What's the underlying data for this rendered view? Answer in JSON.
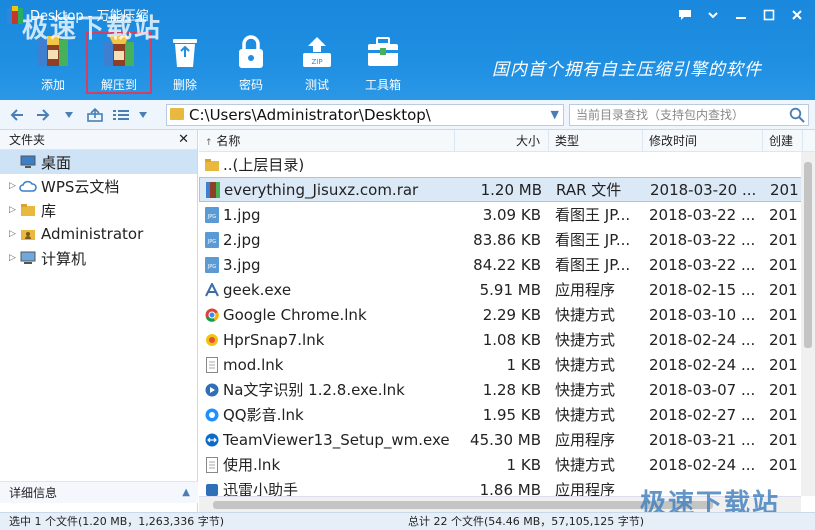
{
  "window": {
    "title": "Desktop - 万能压缩"
  },
  "window_controls": [
    "comment-icon",
    "dropdown-icon",
    "minimize-icon",
    "maximize-icon",
    "close-icon"
  ],
  "toolbar": {
    "buttons": [
      {
        "label": "添加",
        "icon": "add-archive-icon"
      },
      {
        "label": "解压到",
        "icon": "extract-icon",
        "selected": true
      },
      {
        "label": "删除",
        "icon": "recycle-bin-icon"
      },
      {
        "label": "密码",
        "icon": "lock-icon"
      },
      {
        "label": "测试",
        "icon": "test-zip-icon"
      },
      {
        "label": "工具箱",
        "icon": "toolbox-icon"
      }
    ],
    "slogan": "国内首个拥有自主压缩引擎的软件"
  },
  "watermark": {
    "text": "极速下载站"
  },
  "navbar": {
    "address": "C:\\Users\\Administrator\\Desktop\\",
    "search_placeholder": "当前目录查找（支持包内查找）"
  },
  "left_panel": {
    "header": "文件夹",
    "tree": [
      {
        "label": "桌面",
        "icon": "desktop-icon",
        "selected": true
      },
      {
        "label": "WPS云文档",
        "icon": "cloud-icon"
      },
      {
        "label": "库",
        "icon": "library-folder-icon"
      },
      {
        "label": "Administrator",
        "icon": "user-folder-icon"
      },
      {
        "label": "计算机",
        "icon": "computer-icon"
      }
    ],
    "footer": "详细信息"
  },
  "file_list": {
    "columns": {
      "name": "名称",
      "size": "大小",
      "type": "类型",
      "modified": "修改时间",
      "created": "创建"
    },
    "rows": [
      {
        "name": "..(上层目录)",
        "size": "",
        "type": "",
        "modified": "",
        "created": "",
        "icon": "folder-icon"
      },
      {
        "name": "everything_Jisuxz.com.rar",
        "size": "1.20 MB",
        "type": "RAR 文件",
        "modified": "2018-03-20 ...",
        "created": "201",
        "icon": "rar-icon",
        "selected": true
      },
      {
        "name": "1.jpg",
        "size": "3.09 KB",
        "type": "看图王 JP...",
        "modified": "2018-03-22 ...",
        "created": "201",
        "icon": "jpg-icon"
      },
      {
        "name": "2.jpg",
        "size": "83.86 KB",
        "type": "看图王 JP...",
        "modified": "2018-03-22 ...",
        "created": "201",
        "icon": "jpg-icon"
      },
      {
        "name": "3.jpg",
        "size": "84.22 KB",
        "type": "看图王 JP...",
        "modified": "2018-03-22 ...",
        "created": "201",
        "icon": "jpg-icon"
      },
      {
        "name": "geek.exe",
        "size": "5.91 MB",
        "type": "应用程序",
        "modified": "2018-02-15 ...",
        "created": "201",
        "icon": "geek-icon"
      },
      {
        "name": "Google Chrome.lnk",
        "size": "2.29 KB",
        "type": "快捷方式",
        "modified": "2018-03-10 ...",
        "created": "201",
        "icon": "chrome-icon"
      },
      {
        "name": "HprSnap7.lnk",
        "size": "1.08 KB",
        "type": "快捷方式",
        "modified": "2018-02-24 ...",
        "created": "201",
        "icon": "hypersnap-icon"
      },
      {
        "name": "mod.lnk",
        "size": "1 KB",
        "type": "快捷方式",
        "modified": "2018-02-24 ...",
        "created": "201",
        "icon": "document-icon"
      },
      {
        "name": "Na文字识别 1.2.8.exe.lnk",
        "size": "1.28 KB",
        "type": "快捷方式",
        "modified": "2018-03-07 ...",
        "created": "201",
        "icon": "play-icon"
      },
      {
        "name": "QQ影音.lnk",
        "size": "1.95 KB",
        "type": "快捷方式",
        "modified": "2018-02-27 ...",
        "created": "201",
        "icon": "qq-player-icon"
      },
      {
        "name": "TeamViewer13_Setup_wm.exe",
        "size": "45.30 MB",
        "type": "应用程序",
        "modified": "2018-03-21 ...",
        "created": "201",
        "icon": "teamviewer-icon"
      },
      {
        "name": "使用.lnk",
        "size": "1 KB",
        "type": "快捷方式",
        "modified": "2018-02-24 ...",
        "created": "201",
        "icon": "document-icon"
      },
      {
        "name": "迅雷小助手",
        "size": "1.86 MB",
        "type": "应用程序",
        "modified": "",
        "created": "",
        "icon": "app-icon"
      }
    ]
  },
  "status": {
    "left": "选中 1 个文件(1.20 MB，1,263,336 字节)",
    "right": "总计 22 个文件(54.46 MB，57,105,125 字节)"
  },
  "colors": {
    "accent": "#1f8fe2",
    "selection": "#dbe9f7",
    "highlight_box": "#d23f63"
  }
}
